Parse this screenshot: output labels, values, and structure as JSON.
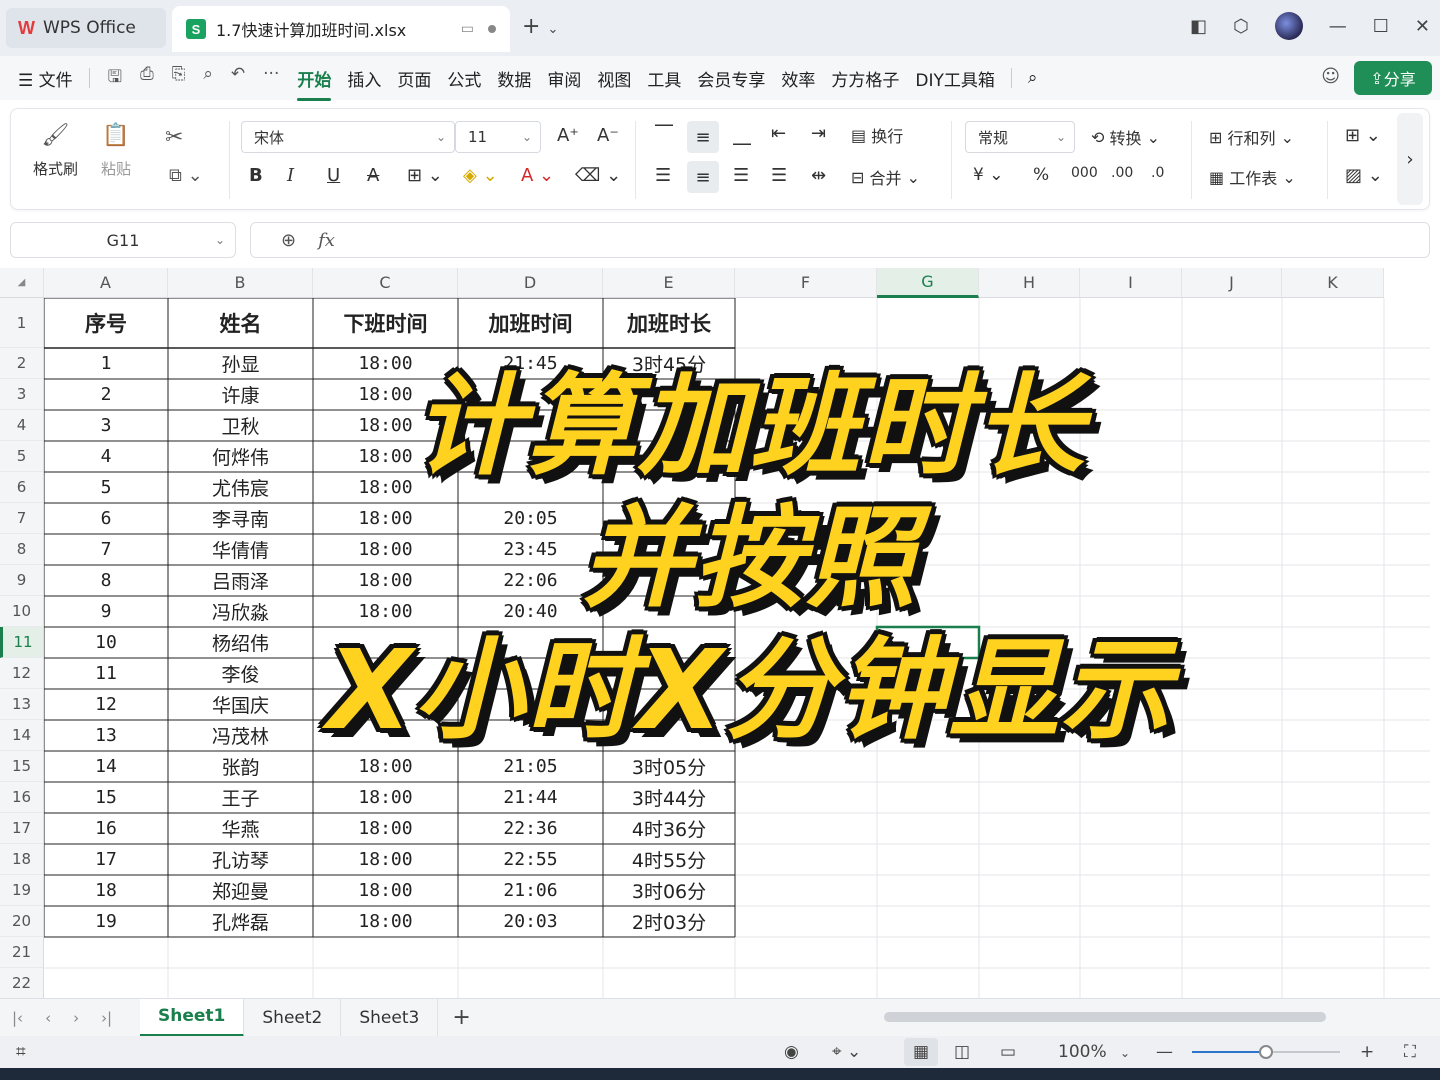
{
  "titlebar": {
    "home_label": "WPS Office",
    "doc_title": "1.7快速计算加班时间.xlsx",
    "new_tab": "+"
  },
  "menubar": {
    "file": "文件",
    "tabs": [
      "开始",
      "插入",
      "页面",
      "公式",
      "数据",
      "审阅",
      "视图",
      "工具",
      "会员专享",
      "效率",
      "方方格子",
      "DIY工具箱"
    ],
    "share": "分享"
  },
  "ribbon": {
    "format_painter": "格式刷",
    "paste": "粘贴",
    "font_name": "宋体",
    "font_size": "11",
    "wrap": "换行",
    "merge": "合并",
    "number_format": "常规",
    "convert": "转换",
    "rows_cols": "行和列",
    "worksheet": "工作表"
  },
  "formula_bar": {
    "name_box": "G11",
    "formula": ""
  },
  "grid": {
    "columns": [
      "A",
      "B",
      "C",
      "D",
      "E",
      "F",
      "G",
      "H",
      "I",
      "J",
      "K"
    ],
    "selected_column": "G",
    "selected_row": "11",
    "headers": [
      "序号",
      "姓名",
      "下班时间",
      "加班时间",
      "加班时长"
    ],
    "rows": [
      [
        "1",
        "孙显",
        "18:00",
        "21:45",
        "3时45分"
      ],
      [
        "2",
        "许康",
        "18:00",
        "",
        ""
      ],
      [
        "3",
        "卫秋",
        "18:00",
        "",
        ""
      ],
      [
        "4",
        "何烨伟",
        "18:00",
        "",
        ""
      ],
      [
        "5",
        "尤伟宸",
        "18:00",
        "",
        ""
      ],
      [
        "6",
        "李寻南",
        "18:00",
        "20:05",
        ""
      ],
      [
        "7",
        "华倩倩",
        "18:00",
        "23:45",
        ""
      ],
      [
        "8",
        "吕雨泽",
        "18:00",
        "22:06",
        ""
      ],
      [
        "9",
        "冯欣淼",
        "18:00",
        "20:40",
        ""
      ],
      [
        "10",
        "杨绍伟",
        "",
        "",
        ""
      ],
      [
        "11",
        "李俊",
        "",
        "",
        ""
      ],
      [
        "12",
        "华国庆",
        "",
        "",
        ""
      ],
      [
        "13",
        "冯茂林",
        "",
        "",
        ""
      ],
      [
        "14",
        "张韵",
        "18:00",
        "21:05",
        "3时05分"
      ],
      [
        "15",
        "王子",
        "18:00",
        "21:44",
        "3时44分"
      ],
      [
        "16",
        "华燕",
        "18:00",
        "22:36",
        "4时36分"
      ],
      [
        "17",
        "孔访琴",
        "18:00",
        "22:55",
        "4时55分"
      ],
      [
        "18",
        "郑迎曼",
        "18:00",
        "21:06",
        "3时06分"
      ],
      [
        "19",
        "孔烨磊",
        "18:00",
        "20:03",
        "2时03分"
      ]
    ]
  },
  "overlay": {
    "line1": "计算加班时长",
    "line2": "并按照",
    "line3": "X小时X分钟显示"
  },
  "sheets": {
    "tabs": [
      "Sheet1",
      "Sheet2",
      "Sheet3"
    ],
    "active": "Sheet1"
  },
  "statusbar": {
    "zoom": "100%",
    "zoom_fraction": 0.5
  },
  "colors": {
    "accent": "#1a7f4d",
    "share_button": "#1f8f57",
    "overlay_fill": "#ffd21f",
    "overlay_stroke": "#111111"
  }
}
